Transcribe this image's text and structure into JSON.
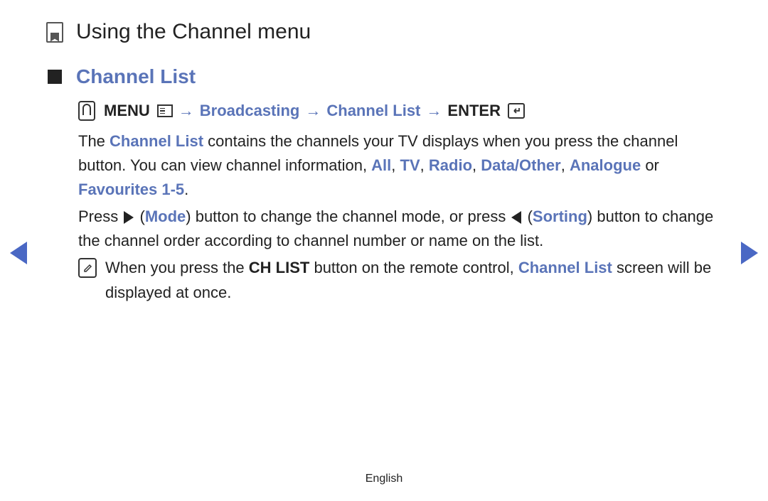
{
  "page": {
    "title": "Using the Channel menu",
    "language": "English"
  },
  "section": {
    "title": "Channel List"
  },
  "breadcrumb": {
    "menu": "MENU",
    "broadcasting": "Broadcasting",
    "channel_list": "Channel List",
    "enter": "ENTER",
    "arrow": "→"
  },
  "paragraph1": {
    "t1": "The ",
    "channel_list": "Channel List",
    "t2": " contains the channels your TV displays when you press the channel button. You can view channel information, ",
    "all": "All",
    "sep": ", ",
    "tv": "TV",
    "radio": "Radio",
    "data_other": "Data/Other",
    "analogue": "Analogue",
    "or": " or ",
    "favourites": "Favourites 1-5",
    "period": "."
  },
  "paragraph2": {
    "t1": "Press ",
    "t2": " (",
    "mode": "Mode",
    "t3": ") button to change the channel mode, or press ",
    "t4": " (",
    "sorting": "Sorting",
    "t5": ") button to change the channel order according to channel number or name on the list."
  },
  "note": {
    "t1": "When you press the ",
    "ch_list": "CH LIST",
    "t2": " button on the remote control, ",
    "channel_list": "Channel List",
    "t3": " screen will be displayed at once."
  }
}
